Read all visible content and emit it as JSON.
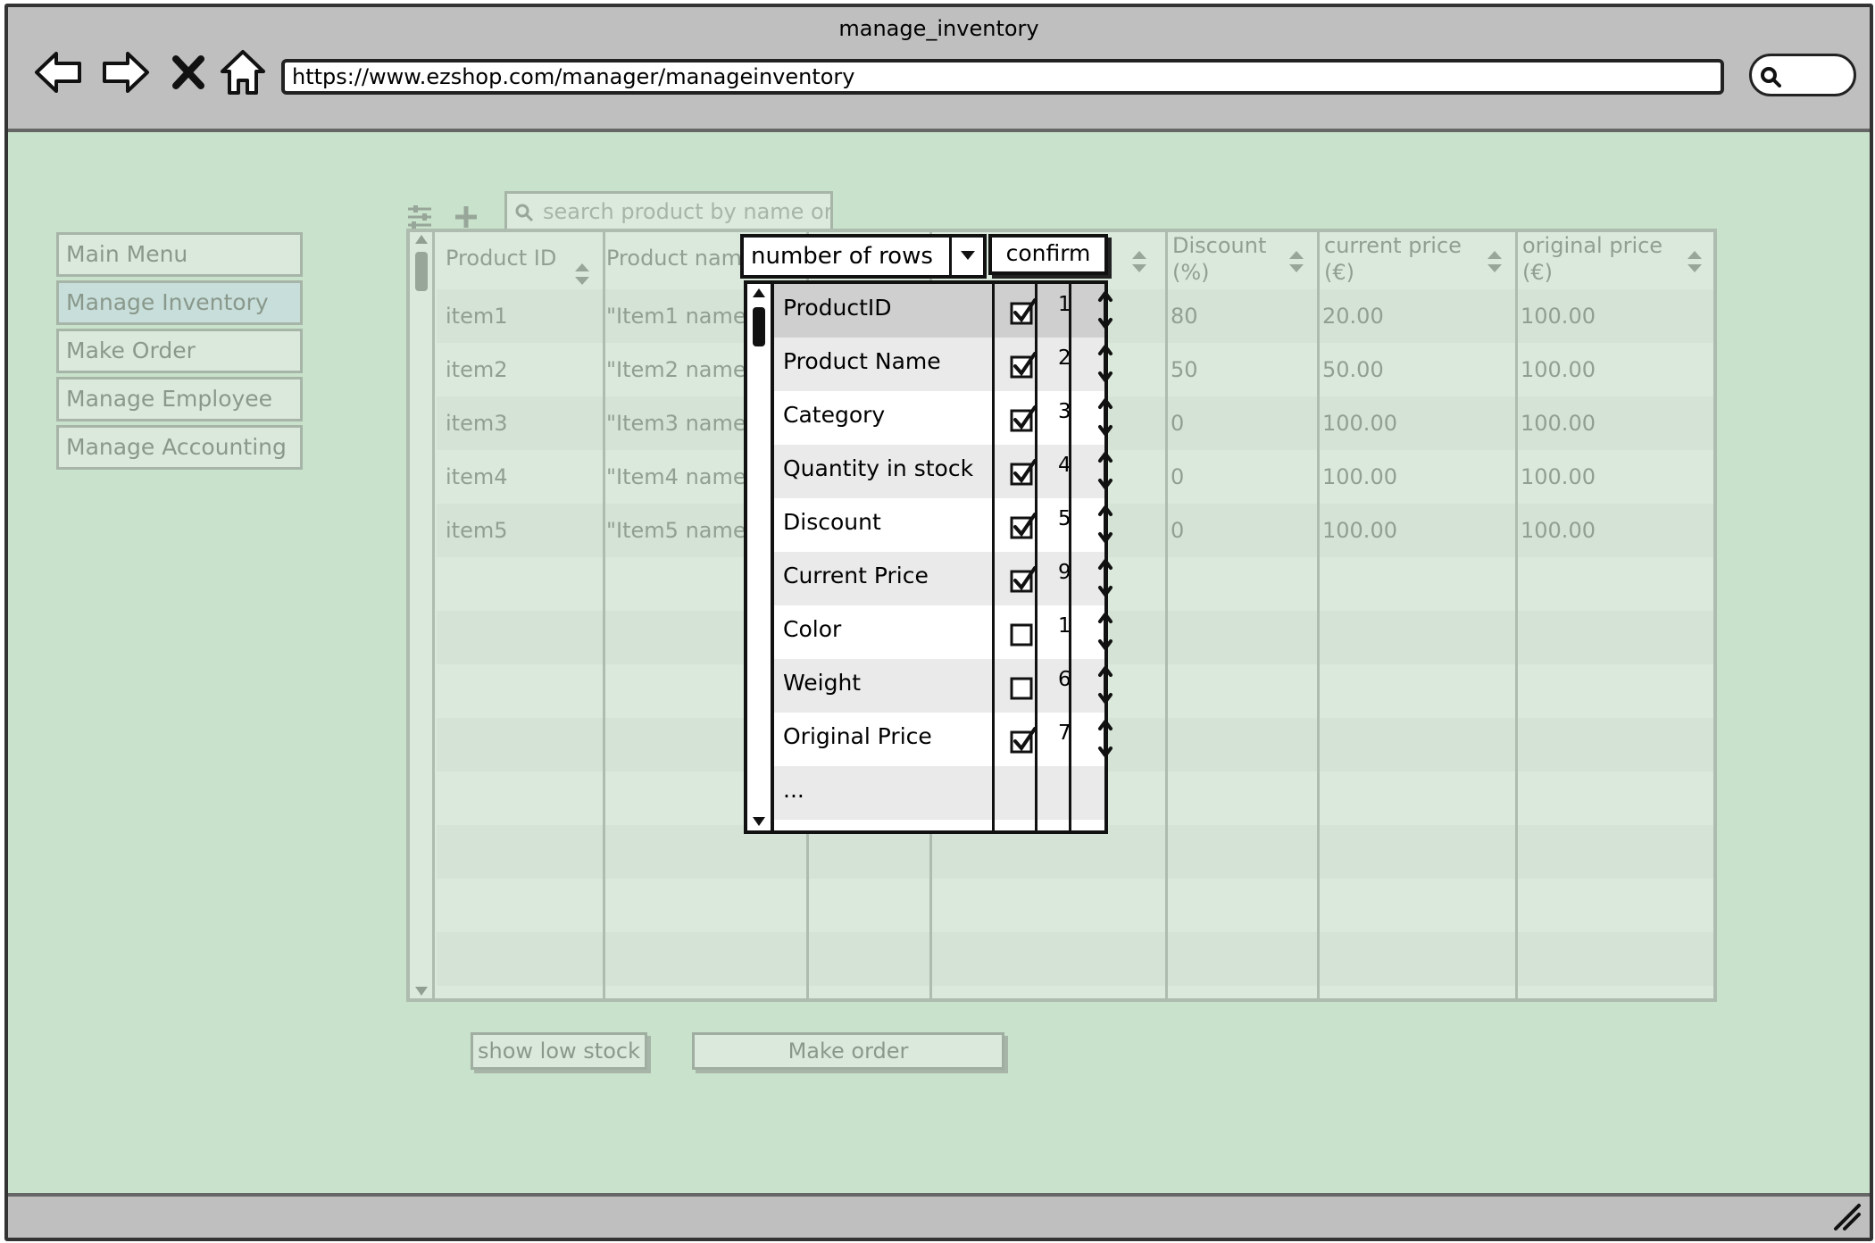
{
  "window": {
    "title": "manage_inventory"
  },
  "browser": {
    "url": "https://www.ezshop.com/manager/manageinventory"
  },
  "sidebar": {
    "items": [
      {
        "label": "Main Menu",
        "active": false
      },
      {
        "label": "Manage Inventory",
        "active": true
      },
      {
        "label": "Make Order",
        "active": false
      },
      {
        "label": "Manage Employee",
        "active": false
      },
      {
        "label": "Manage Accounting",
        "active": false
      }
    ]
  },
  "search": {
    "placeholder": "search product by name or"
  },
  "table": {
    "headers": [
      {
        "line1": "Product ID",
        "line2": ""
      },
      {
        "line1": "Product nam",
        "line2": ""
      },
      {
        "line1": "Discount",
        "line2": "(%)"
      },
      {
        "line1": "current price",
        "line2": "(€)"
      },
      {
        "line1": "original price",
        "line2": "(€)"
      }
    ],
    "rows": [
      {
        "id": "item1",
        "name": "\"Item1 name\"",
        "discount": "80",
        "current": "20.00",
        "original": "100.00"
      },
      {
        "id": "item2",
        "name": "\"Item2 name",
        "discount": "50",
        "current": "50.00",
        "original": "100.00"
      },
      {
        "id": "item3",
        "name": "\"Item3 name",
        "discount": "0",
        "current": "100.00",
        "original": "100.00"
      },
      {
        "id": "item4",
        "name": "\"Item4 name",
        "discount": "0",
        "current": "100.00",
        "original": "100.00"
      },
      {
        "id": "item5",
        "name": "\"Item5 name",
        "discount": "0",
        "current": "100.00",
        "original": "100.00"
      }
    ]
  },
  "buttons": {
    "low_stock": "show low stock",
    "make_order": "Make order"
  },
  "popup": {
    "rows_select": "number of rows",
    "confirm": "confirm",
    "columns": [
      {
        "name": "ProductID",
        "checked": true,
        "order": "1"
      },
      {
        "name": "Product Name",
        "checked": true,
        "order": "2"
      },
      {
        "name": "Category",
        "checked": true,
        "order": "3"
      },
      {
        "name": "Quantity in stock",
        "checked": true,
        "order": "4"
      },
      {
        "name": "Discount",
        "checked": true,
        "order": "5"
      },
      {
        "name": "Current Price",
        "checked": true,
        "order": "9"
      },
      {
        "name": "Color",
        "checked": false,
        "order": "1"
      },
      {
        "name": "Weight",
        "checked": false,
        "order": "6"
      },
      {
        "name": "Original Price",
        "checked": true,
        "order": "7"
      },
      {
        "name": "...",
        "checked": null,
        "order": ""
      }
    ]
  },
  "colors": {
    "canvas": "#c9e2cb",
    "chrome": "#bfbfbf",
    "active_menu": "#c8d9ee"
  }
}
